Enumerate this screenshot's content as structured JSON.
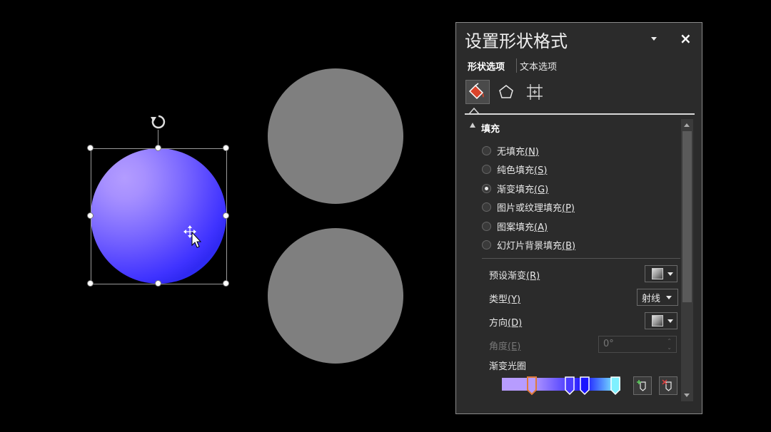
{
  "panel": {
    "title": "设置形状格式",
    "close_label": "×",
    "tabs": [
      "形状选项",
      "文本选项"
    ],
    "category_icons": [
      "fill-line-icon",
      "effects-icon",
      "size-properties-icon"
    ],
    "section_title": "填充",
    "fill_options": [
      {
        "label": "无填充",
        "key": "(N)",
        "checked": false
      },
      {
        "label": "纯色填充",
        "key": "(S)",
        "checked": false
      },
      {
        "label": "渐变填充",
        "key": "(G)",
        "checked": true
      },
      {
        "label": "图片或纹理填充",
        "key": "(P)",
        "checked": false
      },
      {
        "label": "图案填充",
        "key": "(A)",
        "checked": false
      },
      {
        "label": "幻灯片背景填充",
        "key": "(B)",
        "checked": false
      }
    ],
    "preset_gradient": {
      "label": "预设渐变",
      "key": "(R)"
    },
    "type": {
      "label": "类型",
      "key": "(Y)",
      "value": "射线"
    },
    "direction": {
      "label": "方向",
      "key": "(D)"
    },
    "angle": {
      "label": "角度",
      "key": "(E)",
      "value": "0°"
    },
    "gradient_stops_label": "渐变光圈",
    "gradient_stops": [
      {
        "position": 0.25,
        "color": "#b79cff",
        "selected": true
      },
      {
        "position": 0.57,
        "color": "#4a3cff",
        "selected": false
      },
      {
        "position": 0.7,
        "color": "#1a14ff",
        "selected": false
      },
      {
        "position": 0.96,
        "color": "#7ff0ff",
        "selected": false
      }
    ],
    "add_stop_icon": "add-gradient-stop-icon",
    "remove_stop_icon": "remove-gradient-stop-icon"
  },
  "canvas": {
    "shape_colors": {
      "gradient_center": "#b39cff",
      "gradient_edge": "#3d6aff",
      "gray": "#7f7f7f"
    }
  }
}
